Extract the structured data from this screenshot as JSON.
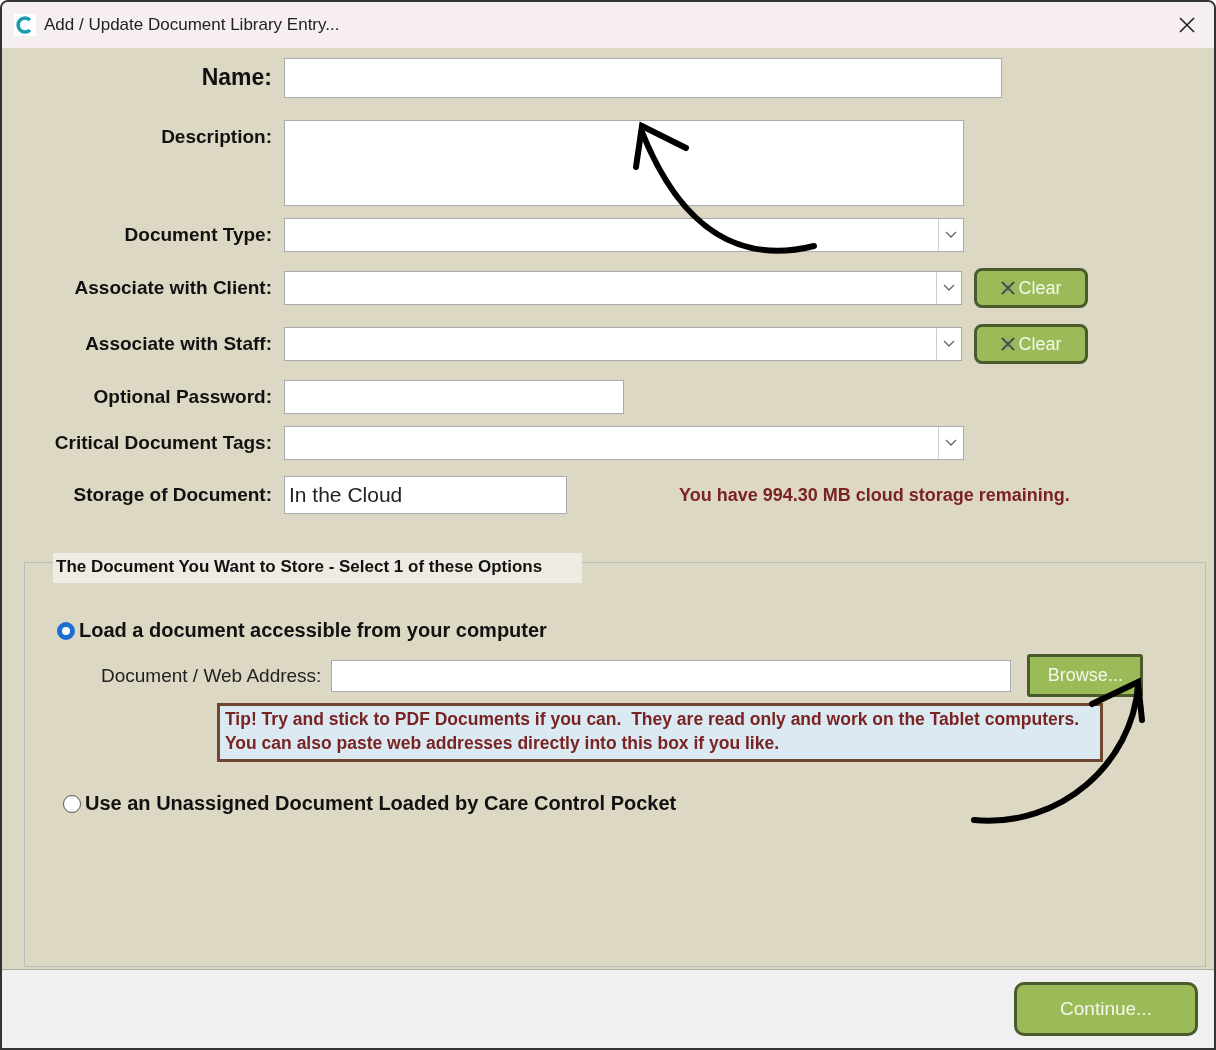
{
  "window": {
    "title": "Add / Update Document Library Entry..."
  },
  "fields": [
    {
      "kind": "name",
      "label": "Name:"
    },
    {
      "kind": "textarea",
      "label": "Description:"
    },
    {
      "kind": "dropdown",
      "label": "Document Type:"
    },
    {
      "kind": "dropdown",
      "label": "Associate with Client:",
      "clear_button": "Clear"
    },
    {
      "kind": "dropdown",
      "label": "Associate with Staff:",
      "clear_button": "Clear"
    },
    {
      "kind": "short",
      "label": "Optional Password:"
    },
    {
      "kind": "dropdown",
      "label": "Critical Document Tags:"
    },
    {
      "kind": "value",
      "label": "Storage of Document:",
      "value": "In the Cloud",
      "note": "You have 994.30 MB cloud storage remaining."
    }
  ],
  "options_group": {
    "title": "The Document You Want to Store - Select 1 of these Options",
    "options": [
      {
        "label": "Load a document accessible from your computer",
        "selected": true,
        "address_label": "Document / Web Address:",
        "browse_button": "Browse...",
        "tip": "Tip! Try and stick to PDF Documents if you can.  They are read only and work on the Tablet computers.  You can also paste web addresses directly into this box if you like."
      },
      {
        "label": "Use an Unassigned Document Loaded by Care Control Pocket",
        "selected": false
      }
    ]
  },
  "footer": {
    "button": "Continue..."
  }
}
